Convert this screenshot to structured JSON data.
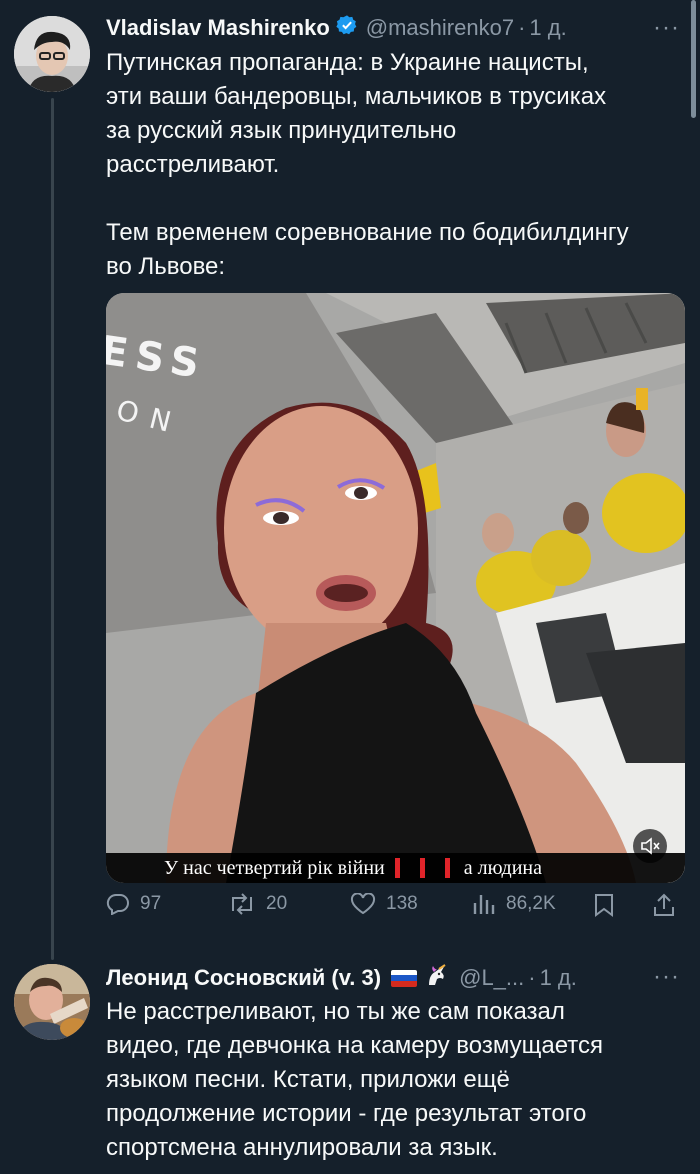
{
  "tweet1": {
    "display_name": "Vladislav Mashirenko",
    "handle": "@mashirenko7",
    "separator": "·",
    "time": "1 д.",
    "text_lines": [
      "Путинская пропаганда: в Украине нацисты,",
      "эти ваши бандеровцы, мальчиков в трусиках",
      "за русский язык принудительно",
      "расстреливают.",
      "",
      "Тем временем соревнование по бодибилдингу",
      "во Львове:"
    ],
    "media": {
      "wall_text_1": "ESS",
      "wall_text_2": "ON",
      "caption": "У нас четвертий рік війни",
      "caption_tail": "а людина",
      "mute_icon": "mute-icon"
    },
    "actions": {
      "replies": "97",
      "reposts": "20",
      "likes": "138",
      "views": "86,2K"
    }
  },
  "tweet2": {
    "display_name": "Леонид Сосновский (v. 3)",
    "flag": "🇷🇺",
    "emoji": "🦄",
    "handle": "@L_...",
    "separator": "·",
    "time": "1 д.",
    "text_lines": [
      "Не расстреливают, но ты же сам показал",
      "видео, где девчонка на камеру возмущается",
      "языком песни. Кстати, приложи ещё",
      "продолжение истории - где результат этого",
      "спортсмена аннулировали за язык."
    ]
  },
  "more_glyph": "···",
  "colors": {
    "background": "#15202b",
    "text": "#f7f9f9",
    "muted": "#8b98a5",
    "verified": "#1d9bf0"
  }
}
